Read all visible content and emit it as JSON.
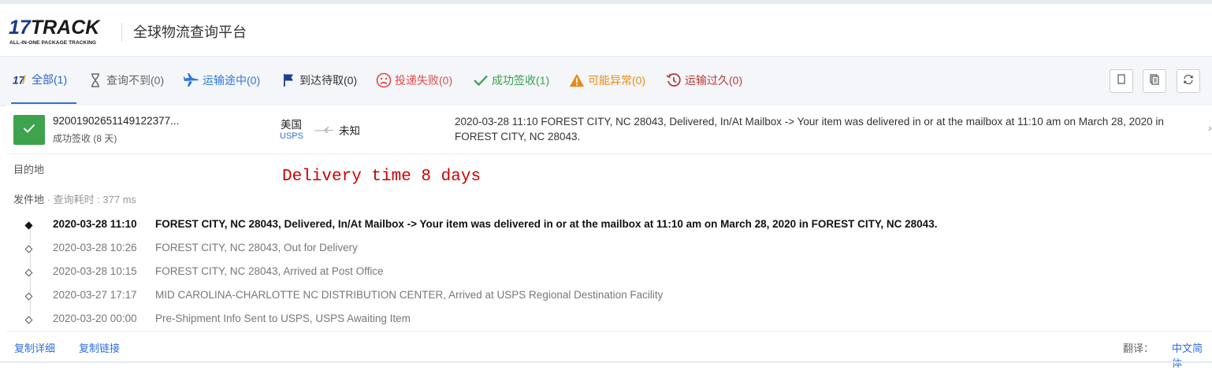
{
  "brand": {
    "logo_main_prefix": "17",
    "logo_main_suffix": "TRACK",
    "logo_sub": "ALL-IN-ONE PACKAGE TRACKING",
    "site_title": "全球物流查询平台"
  },
  "tabs": [
    {
      "label": "全部(1)",
      "icon": "seventeen-logo-icon",
      "color": "#2b5fd1",
      "active": true
    },
    {
      "label": "查询不到(0)",
      "icon": "hourglass-icon",
      "color": "#666666"
    },
    {
      "label": "运输途中(0)",
      "icon": "airplane-icon",
      "color": "#2f78d8"
    },
    {
      "label": "到达待取(0)",
      "icon": "flag-icon",
      "color": "#1d3f8f"
    },
    {
      "label": "投递失败(0)",
      "icon": "sad-face-icon",
      "color": "#e04949"
    },
    {
      "label": "成功签收(1)",
      "icon": "checkmark-icon",
      "color": "#35a14a"
    },
    {
      "label": "可能异常(0)",
      "icon": "warning-icon",
      "color": "#e88a16"
    },
    {
      "label": "运输过久(0)",
      "icon": "clock-history-icon",
      "color": "#b53a3a"
    }
  ],
  "toolbar": {
    "buttons": [
      "copy-icon",
      "copy-all-icon",
      "refresh-icon"
    ]
  },
  "package": {
    "tracking_number": "92001902651149122377...",
    "status": "成功签收 (8 天)",
    "status_color": "#3da34d",
    "origin_country": "美国",
    "origin_carrier": "USPS",
    "destination_country": "未知",
    "latest_event": "2020-03-28 11:10  FOREST CITY, NC 28043, Delivered, In/At Mailbox -> Your item was delivered in or at the mailbox at 11:10 am on March 28, 2020 in FOREST CITY, NC 28043."
  },
  "details": {
    "destination_label": "目的地",
    "origin_label": "发件地",
    "separator": " · ",
    "query_time": "查询耗时 : 377 ms",
    "annotation": "Delivery time 8 days"
  },
  "events": [
    {
      "time": "2020-03-28 11:10",
      "description": "FOREST CITY, NC 28043, Delivered, In/At Mailbox -> Your item was delivered in or at the mailbox at 11:10 am on March 28, 2020 in FOREST CITY, NC 28043."
    },
    {
      "time": "2020-03-28 10:26",
      "description": "FOREST CITY, NC 28043, Out for Delivery"
    },
    {
      "time": "2020-03-28 10:15",
      "description": "FOREST CITY, NC 28043, Arrived at Post Office"
    },
    {
      "time": "2020-03-27 17:17",
      "description": "MID CAROLINA-CHARLOTTE NC DISTRIBUTION CENTER, Arrived at USPS Regional Destination Facility"
    },
    {
      "time": "2020-03-20 00:00",
      "description": "Pre-Shipment Info Sent to USPS, USPS Awaiting Item"
    }
  ],
  "footer": {
    "copy_details": "复制详细",
    "copy_link": "复制链接",
    "translate_label": "翻译：",
    "translate_value": "中文简体"
  }
}
